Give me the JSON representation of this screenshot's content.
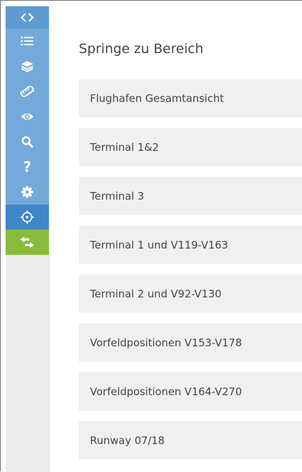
{
  "sidebar": {
    "buttons": [
      {
        "name": "toggle-sidebar",
        "icon": "code-brackets-icon"
      },
      {
        "name": "list",
        "icon": "list-icon"
      },
      {
        "name": "layers",
        "icon": "layers-icon"
      },
      {
        "name": "measure",
        "icon": "measure-tag-icon"
      },
      {
        "name": "visibility",
        "icon": "eye-icon"
      },
      {
        "name": "search",
        "icon": "search-icon"
      },
      {
        "name": "help",
        "icon": "question-icon"
      },
      {
        "name": "settings",
        "icon": "gear-icon"
      },
      {
        "name": "jump-to-area",
        "icon": "crosshair-icon",
        "active": true
      },
      {
        "name": "swap",
        "icon": "swap-arrows-icon"
      }
    ],
    "colors": {
      "button": "#74a9d9",
      "toggle": "#5d9bd1",
      "active": "#3f87c7",
      "swap": "#8bbb3c",
      "background": "#ececec"
    }
  },
  "panel": {
    "title": "Springe zu Bereich",
    "items": [
      {
        "label": "Flughafen Gesamtansicht"
      },
      {
        "label": "Terminal 1&2"
      },
      {
        "label": "Terminal 3"
      },
      {
        "label": "Terminal 1 und V119-V163"
      },
      {
        "label": "Terminal 2 und V92-V130"
      },
      {
        "label": "Vorfeldpositionen V153-V178"
      },
      {
        "label": "Vorfeldpositionen V164-V270"
      },
      {
        "label": "Runway 07/18"
      }
    ]
  }
}
